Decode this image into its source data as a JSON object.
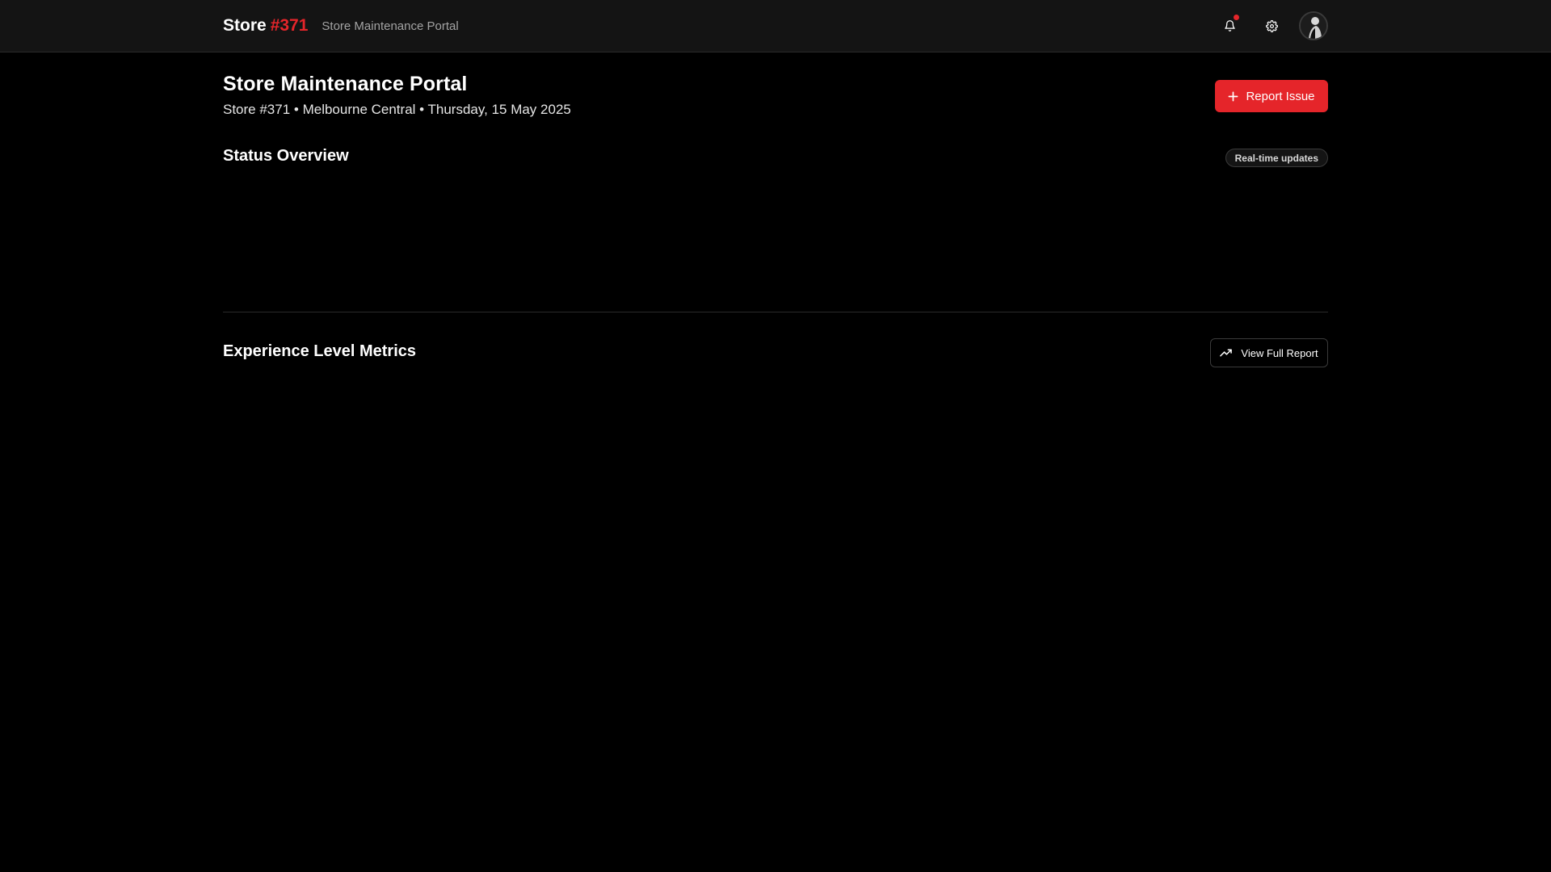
{
  "topbar": {
    "brand_word": "Store",
    "brand_number": "#371",
    "portal_name": "Store Maintenance Portal",
    "icons": {
      "notifications": "bell-icon",
      "settings": "gear-icon",
      "profile": "avatar"
    },
    "has_unread_notifications": true
  },
  "header": {
    "title": "Store Maintenance Portal",
    "meta": "Store #371 • Melbourne Central • Thursday, 15 May 2025",
    "report_button_label": "Report Issue",
    "report_button_icon": "plus-icon"
  },
  "status_overview": {
    "title": "Status Overview",
    "badge": "Real-time updates"
  },
  "metrics": {
    "title": "Experience Level Metrics",
    "view_button_label": "View Full Report",
    "view_button_icon": "trending-up-icon"
  },
  "colors": {
    "accent": "#e5252a",
    "background": "#000000",
    "topbar": "#141414",
    "border": "#2a2a2a",
    "muted_text": "#a3a3a3"
  }
}
